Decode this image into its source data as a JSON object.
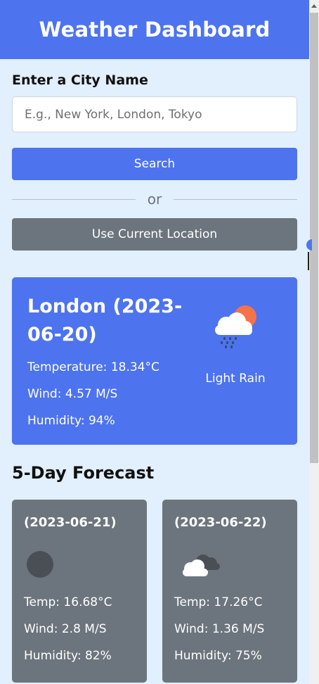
{
  "header": {
    "title": "Weather Dashboard"
  },
  "search": {
    "label": "Enter a City Name",
    "placeholder": "E.g., New York, London, Tokyo",
    "value": "",
    "search_button": "Search",
    "divider_text": "or",
    "location_button": "Use Current Location"
  },
  "current": {
    "city_date": "London (2023-06-20)",
    "temperature": "Temperature: 18.34°C",
    "wind": "Wind: 4.57 M/S",
    "humidity": "Humidity: 94%",
    "description": "Light Rain",
    "icon": "light-rain-icon"
  },
  "forecast": {
    "heading": "5-Day Forecast",
    "days": [
      {
        "date": "(2023-06-21)",
        "icon": "overcast-icon",
        "temp": "Temp: 16.68°C",
        "wind": "Wind: 2.8 M/S",
        "humidity": "Humidity: 82%"
      },
      {
        "date": "(2023-06-22)",
        "icon": "broken-clouds-icon",
        "temp": "Temp: 17.26°C",
        "wind": "Wind: 1.36 M/S",
        "humidity": "Humidity: 75%"
      }
    ]
  },
  "colors": {
    "primary": "#4d73ef",
    "secondary": "#6c757d",
    "background": "#e2effd",
    "sun": "#f4734a"
  }
}
